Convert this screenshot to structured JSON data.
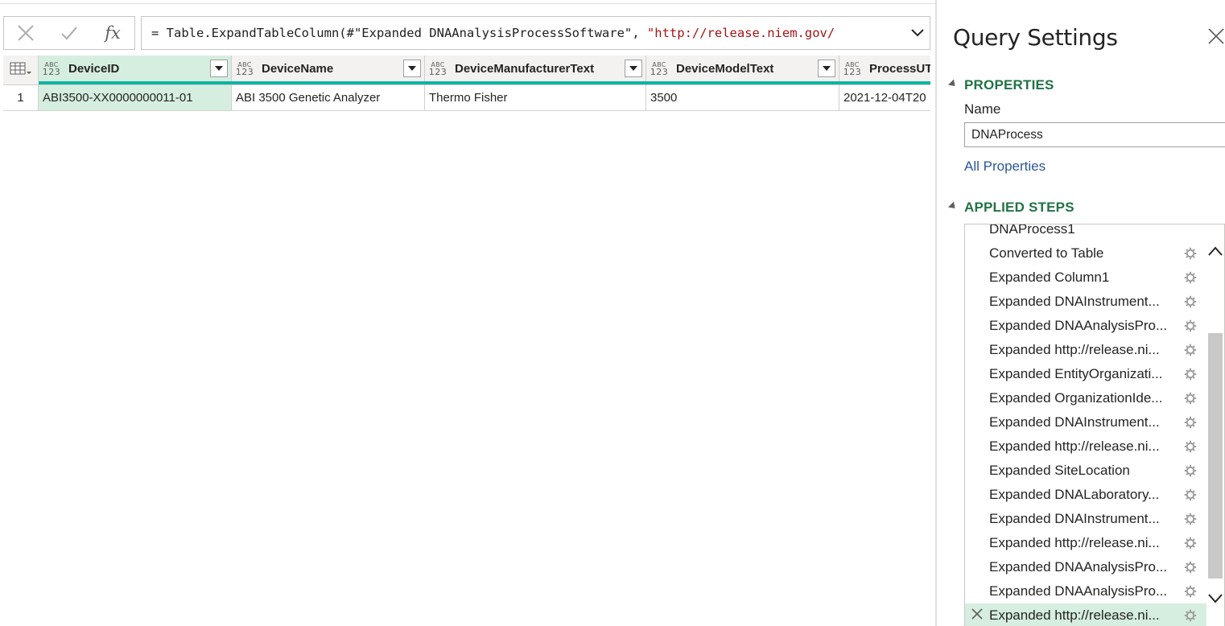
{
  "formula_bar": {
    "fx_label": "fx",
    "formula_prefix": "= Table.ExpandTableColumn(#\"Expanded DNAAnalysisProcessSoftware\", ",
    "formula_string": "\"http://release.niem.gov/"
  },
  "grid": {
    "columns": [
      {
        "name": "DeviceID",
        "type_top": "ABC",
        "type_bottom": "123"
      },
      {
        "name": "DeviceName",
        "type_top": "ABC",
        "type_bottom": "123"
      },
      {
        "name": "DeviceManufacturerText",
        "type_top": "ABC",
        "type_bottom": "123"
      },
      {
        "name": "DeviceModelText",
        "type_top": "ABC",
        "type_bottom": "123"
      },
      {
        "name": "ProcessUT",
        "type_top": "ABC",
        "type_bottom": "123"
      }
    ],
    "rows": [
      {
        "row_number": "1",
        "cells": [
          "ABI3500-XX0000000011-01",
          "ABI 3500 Genetic Analyzer",
          "Thermo Fisher",
          "3500",
          "2021-12-04T20"
        ]
      }
    ]
  },
  "query_settings": {
    "title": "Query Settings",
    "properties_header": "PROPERTIES",
    "name_label": "Name",
    "name_value": "DNAProcess",
    "all_properties_link": "All Properties",
    "applied_steps_header": "APPLIED STEPS",
    "steps": [
      "DNAProcess1",
      "Converted to Table",
      "Expanded Column1",
      "Expanded DNAInstrument...",
      "Expanded DNAAnalysisPro...",
      "Expanded http://release.ni...",
      "Expanded EntityOrganizati...",
      "Expanded OrganizationIde...",
      "Expanded DNAInstrument...",
      "Expanded http://release.ni...",
      "Expanded SiteLocation",
      "Expanded DNALaboratory...",
      "Expanded DNAInstrument...",
      "Expanded http://release.ni...",
      "Expanded DNAAnalysisPro...",
      "Expanded DNAAnalysisPro...",
      "Expanded http://release.ni..."
    ],
    "selected_step_index": 16
  }
}
